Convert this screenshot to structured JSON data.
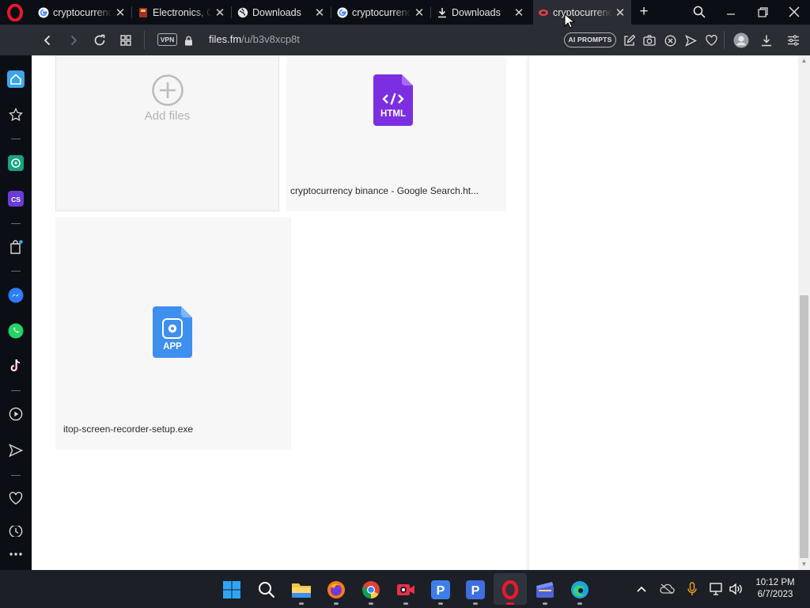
{
  "tabs": [
    {
      "title": "cryptocurrenc",
      "favicon": "google-icon",
      "active": false
    },
    {
      "title": "Electronics, C",
      "favicon": "store-icon",
      "active": false
    },
    {
      "title": "Downloads",
      "favicon": "globe-icon",
      "active": false
    },
    {
      "title": "cryptocurrenc",
      "favicon": "google-icon",
      "active": false
    },
    {
      "title": "Downloads",
      "favicon": "download-icon",
      "active": false
    },
    {
      "title": "cryptocurrenc",
      "favicon": "filesfm-icon",
      "active": true
    }
  ],
  "toolbar": {
    "vpn_label": "VPN",
    "url_domain": "files.fm",
    "url_path": "/u/b3v8xcp8t",
    "ai_prompts_label": "AI PROMPTS"
  },
  "files": {
    "add_label": "Add files",
    "items": [
      {
        "name": "cryptocurrency binance - Google Search.ht...",
        "type_label": "HTML",
        "icon_color": "#7b2fe0"
      },
      {
        "name": "itop-screen-recorder-setup.exe",
        "type_label": "APP",
        "icon_color": "#3d8ff0"
      }
    ]
  },
  "taskbar": {
    "time": "10:12 PM",
    "date": "6/7/2023"
  },
  "colors": {
    "browser_chrome": "#2a2d33",
    "tab_strip": "#0b0e14",
    "opera_red": "#e8182c",
    "taskbar": "#1c1f26"
  }
}
